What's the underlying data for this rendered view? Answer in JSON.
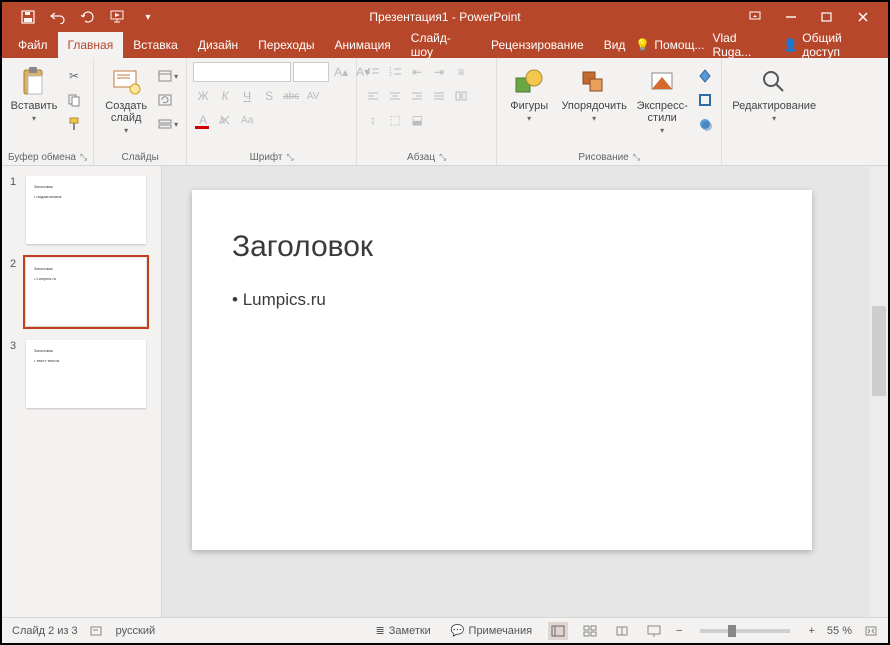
{
  "colors": {
    "accent": "#b7472a"
  },
  "titlebar": {
    "title": "Презентация1 - PowerPoint"
  },
  "tabs": {
    "file": "Файл",
    "items": [
      "Главная",
      "Вставка",
      "Дизайн",
      "Переходы",
      "Анимация",
      "Слайд-шоу",
      "Рецензирование",
      "Вид"
    ],
    "active_index": 0,
    "tell_me": "Помощ...",
    "user": "Vlad Ruga...",
    "share": "Общий доступ"
  },
  "ribbon": {
    "clipboard": {
      "paste": "Вставить",
      "caption": "Буфер обмена"
    },
    "slides": {
      "new_slide": "Создать\nслайд",
      "caption": "Слайды"
    },
    "font": {
      "caption": "Шрифт",
      "buttons": [
        "Ж",
        "К",
        "Ч",
        "S",
        "abc",
        "AV"
      ],
      "case": "Aa"
    },
    "paragraph": {
      "caption": "Абзац"
    },
    "drawing": {
      "shapes": "Фигуры",
      "arrange": "Упорядочить",
      "styles": "Экспресс-\nстили",
      "caption": "Рисование"
    },
    "editing": {
      "label": "Редактирование"
    }
  },
  "thumbnails": [
    {
      "n": "1",
      "title": "Заголовок",
      "body": "• подзаголовок"
    },
    {
      "n": "2",
      "title": "Заголовок",
      "body": "• Lumpics.ru"
    },
    {
      "n": "3",
      "title": "Заголовок",
      "body": "• текст текста"
    }
  ],
  "selected_thumb": 1,
  "slide": {
    "title": "Заголовок",
    "body": "Lumpics.ru"
  },
  "status": {
    "slide_counter": "Слайд 2 из 3",
    "language": "русский",
    "notes": "Заметки",
    "comments": "Примечания",
    "zoom": "55 %"
  }
}
